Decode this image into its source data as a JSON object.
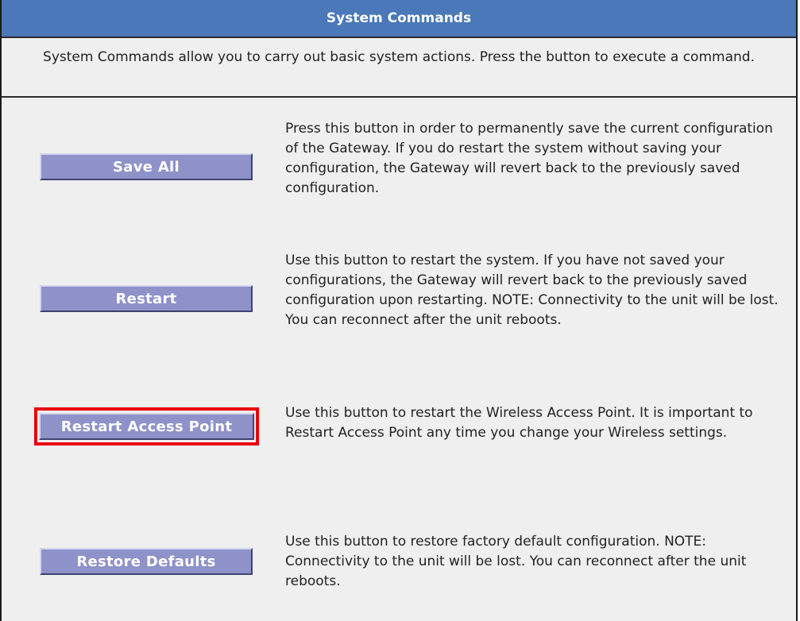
{
  "header": {
    "title": "System Commands"
  },
  "intro": {
    "text": "System Commands allow you to carry out basic system actions. Press the button to execute a command."
  },
  "commands": [
    {
      "button_label": "Save All",
      "description": "Press this button in order to permanently save the current configuration of the Gateway. If you do restart the system without saving your configuration, the Gateway will revert back to the previously saved configuration."
    },
    {
      "button_label": "Restart",
      "description": "Use this button to restart the system. If you have not saved your configurations, the Gateway will revert back to the previously saved configuration upon restarting. NOTE: Connectivity to the unit will be lost. You can reconnect after the unit reboots."
    },
    {
      "button_label": "Restart Access Point",
      "description": "Use this button to restart the Wireless Access Point. It is important to Restart Access Point any time you change your Wireless settings.",
      "highlighted": true
    },
    {
      "button_label": "Restore Defaults",
      "description": "Use this button to restore factory default configuration. NOTE: Connectivity to the unit will be lost. You can reconnect after the unit reboots."
    }
  ],
  "colors": {
    "header_bg": "#4a78b8",
    "panel_bg": "#efefef",
    "button_bg": "#8e92c8",
    "highlight": "#e8000a"
  }
}
